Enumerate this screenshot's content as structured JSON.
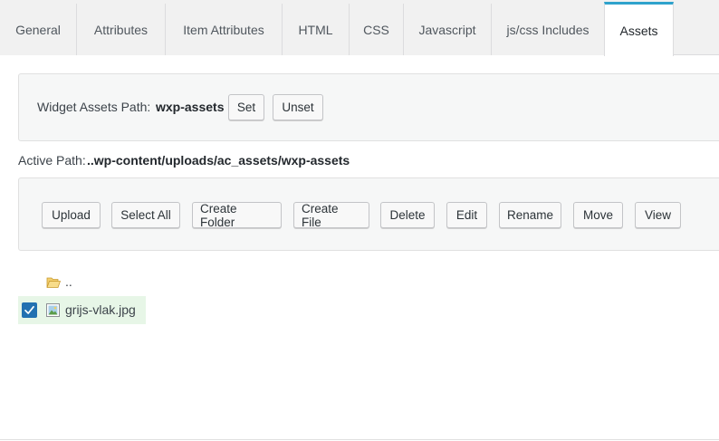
{
  "tabs": [
    {
      "label": "General"
    },
    {
      "label": "Attributes"
    },
    {
      "label": "Item Attributes"
    },
    {
      "label": "HTML"
    },
    {
      "label": "CSS"
    },
    {
      "label": "Javascript"
    },
    {
      "label": "js/css Includes"
    },
    {
      "label": "Assets",
      "active": true
    }
  ],
  "assets_path": {
    "label": "Widget Assets Path:",
    "value": "wxp-assets",
    "set_label": "Set",
    "unset_label": "Unset"
  },
  "active_path": {
    "label": "Active Path:",
    "value": "..wp-content/uploads/ac_assets/wxp-assets"
  },
  "toolbar": {
    "upload": "Upload",
    "select_all": "Select All",
    "create_folder": "Create Folder",
    "create_file": "Create File",
    "delete": "Delete",
    "edit": "Edit",
    "rename": "Rename",
    "move": "Move",
    "view": "View"
  },
  "files": [
    {
      "name": "..",
      "icon": "folder-open-icon",
      "selected": false
    },
    {
      "name": "grijs-vlak.jpg",
      "icon": "image-file-icon",
      "selected": true
    }
  ],
  "colors": {
    "tab_active_accent": "#2ea2cc",
    "selected_row_bg": "#e7f6e7",
    "checkbox_checked": "#2271b1",
    "folder_icon": "#e6b74c"
  }
}
